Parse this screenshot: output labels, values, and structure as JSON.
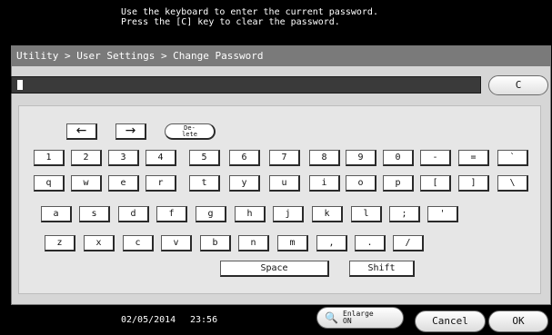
{
  "header": {
    "message_line1": "Use the keyboard to enter the current password.",
    "message_line2": "Press the [C] key to clear the password."
  },
  "breadcrumb": "Utility > User Settings > Change Password",
  "password": {
    "clear_label": "C"
  },
  "keyboard": {
    "left_arrow": "←",
    "right_arrow": "→",
    "delete_line1": "De-",
    "delete_line2": "lete",
    "row1": [
      "1",
      "2",
      "3",
      "4",
      "5",
      "6",
      "7",
      "8",
      "9",
      "0",
      "-",
      "=",
      "`"
    ],
    "row2": [
      "q",
      "w",
      "e",
      "r",
      "t",
      "y",
      "u",
      "i",
      "o",
      "p",
      "[",
      "]",
      "\\"
    ],
    "row3": [
      "a",
      "s",
      "d",
      "f",
      "g",
      "h",
      "j",
      "k",
      "l",
      ";",
      "'"
    ],
    "row4": [
      "z",
      "x",
      "c",
      "v",
      "b",
      "n",
      "m",
      ",",
      ".",
      "/"
    ],
    "space": "Space",
    "shift": "Shift"
  },
  "footer": {
    "date": "02/05/2014",
    "time": "23:56",
    "enlarge_line1": "Enlarge",
    "enlarge_line2": "ON",
    "cancel": "Cancel",
    "ok": "OK"
  }
}
